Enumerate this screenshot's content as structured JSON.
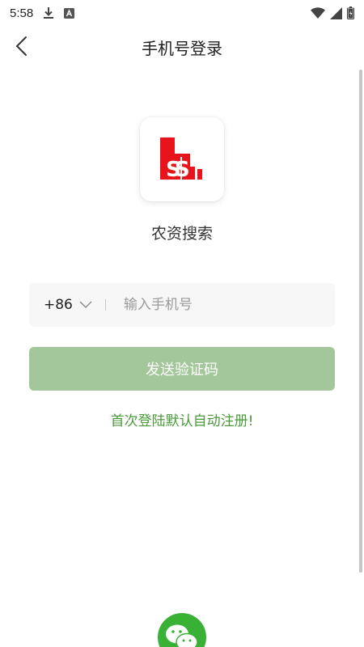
{
  "status_bar": {
    "time": "5:58",
    "icons": [
      "download-icon",
      "a-badge-icon",
      "wifi-icon",
      "signal-icon",
      "battery-icon"
    ]
  },
  "header": {
    "title": "手机号登录",
    "back_icon": "chevron-left-icon"
  },
  "app": {
    "name": "农资搜索",
    "logo_color": "#e8141c"
  },
  "login_form": {
    "country_code": "+86",
    "phone_placeholder": "输入手机号",
    "phone_value": "",
    "send_code_label": "发送验证码",
    "hint": "首次登陆默认自动注册!"
  },
  "social_login": {
    "wechat_icon": "wechat-icon",
    "wechat_color": "#38b135"
  },
  "colors": {
    "accent_green": "#4a9a3a",
    "button_disabled_green": "#a3c79a"
  }
}
